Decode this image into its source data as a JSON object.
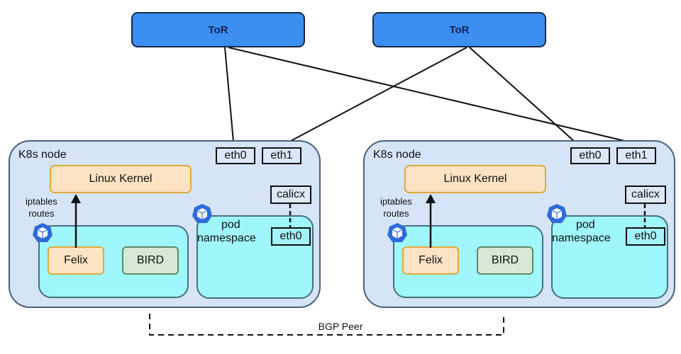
{
  "tors": [
    {
      "label": "ToR"
    },
    {
      "label": "ToR"
    }
  ],
  "nodes": [
    {
      "label": "K8s node",
      "kernel": "Linux Kernel",
      "interfaces": {
        "eth0": "eth0",
        "eth1": "eth1",
        "calicx": "calicx",
        "pod_eth0": "eth0"
      },
      "iptables_line1": "iptables",
      "iptables_line2": "routes",
      "felix": "Felix",
      "bird": "BIRD",
      "pod_ns_line1": "pod",
      "pod_ns_line2": "namespace"
    },
    {
      "label": "K8s node",
      "kernel": "Linux Kernel",
      "interfaces": {
        "eth0": "eth0",
        "eth1": "eth1",
        "calicx": "calicx",
        "pod_eth0": "eth0"
      },
      "iptables_line1": "iptables",
      "iptables_line2": "routes",
      "felix": "Felix",
      "bird": "BIRD",
      "pod_ns_line1": "pod",
      "pod_ns_line2": "namespace"
    }
  ],
  "bgp": {
    "label": "BGP Peer"
  },
  "colors": {
    "tor_fill": "#3c8ef0",
    "node_fill": "#d5e4f7",
    "namespace_fill": "#9ff6fb",
    "kernel_fill": "#fce3c3",
    "bird_fill": "#d6e9d6",
    "k8s_icon": "#2f6bd8"
  },
  "links": [
    {
      "from": "tor-1",
      "to": "node-1-eth0"
    },
    {
      "from": "tor-1",
      "to": "node-2-eth1"
    },
    {
      "from": "tor-2",
      "to": "node-1-eth1"
    },
    {
      "from": "tor-2",
      "to": "node-2-eth0"
    }
  ]
}
